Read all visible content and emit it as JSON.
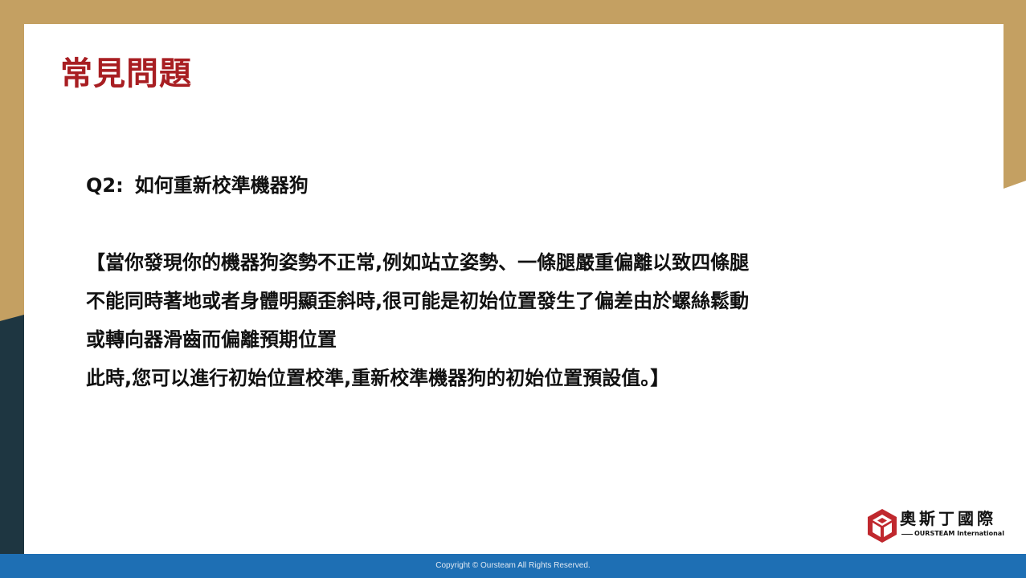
{
  "slide": {
    "title": "常見問題",
    "question": {
      "label": "Q2:",
      "text": "如何重新校準機器狗"
    },
    "answer_lines": [
      "【當你發現你的機器狗姿勢不正常,例如站立姿勢、一條腿嚴重偏離以致四條腿",
      "不能同時著地或者身體明顯歪斜時,很可能是初始位置發生了偏差由於螺絲鬆動",
      "或轉向器滑齒而偏離預期位置",
      "此時,您可以進行初始位置校準,重新校準機器狗的初始位置預設值。】"
    ]
  },
  "logo": {
    "cn": "奧斯丁國際",
    "en": "OURSTEAM International",
    "icon": "cube-logo-icon"
  },
  "footer": {
    "copyright": "Copyright © Oursteam All Rights Reserved."
  },
  "colors": {
    "gold": "#c4a062",
    "dark_teal": "#1e3641",
    "title_red": "#a81e22",
    "footer_blue": "#1e6fb4"
  }
}
